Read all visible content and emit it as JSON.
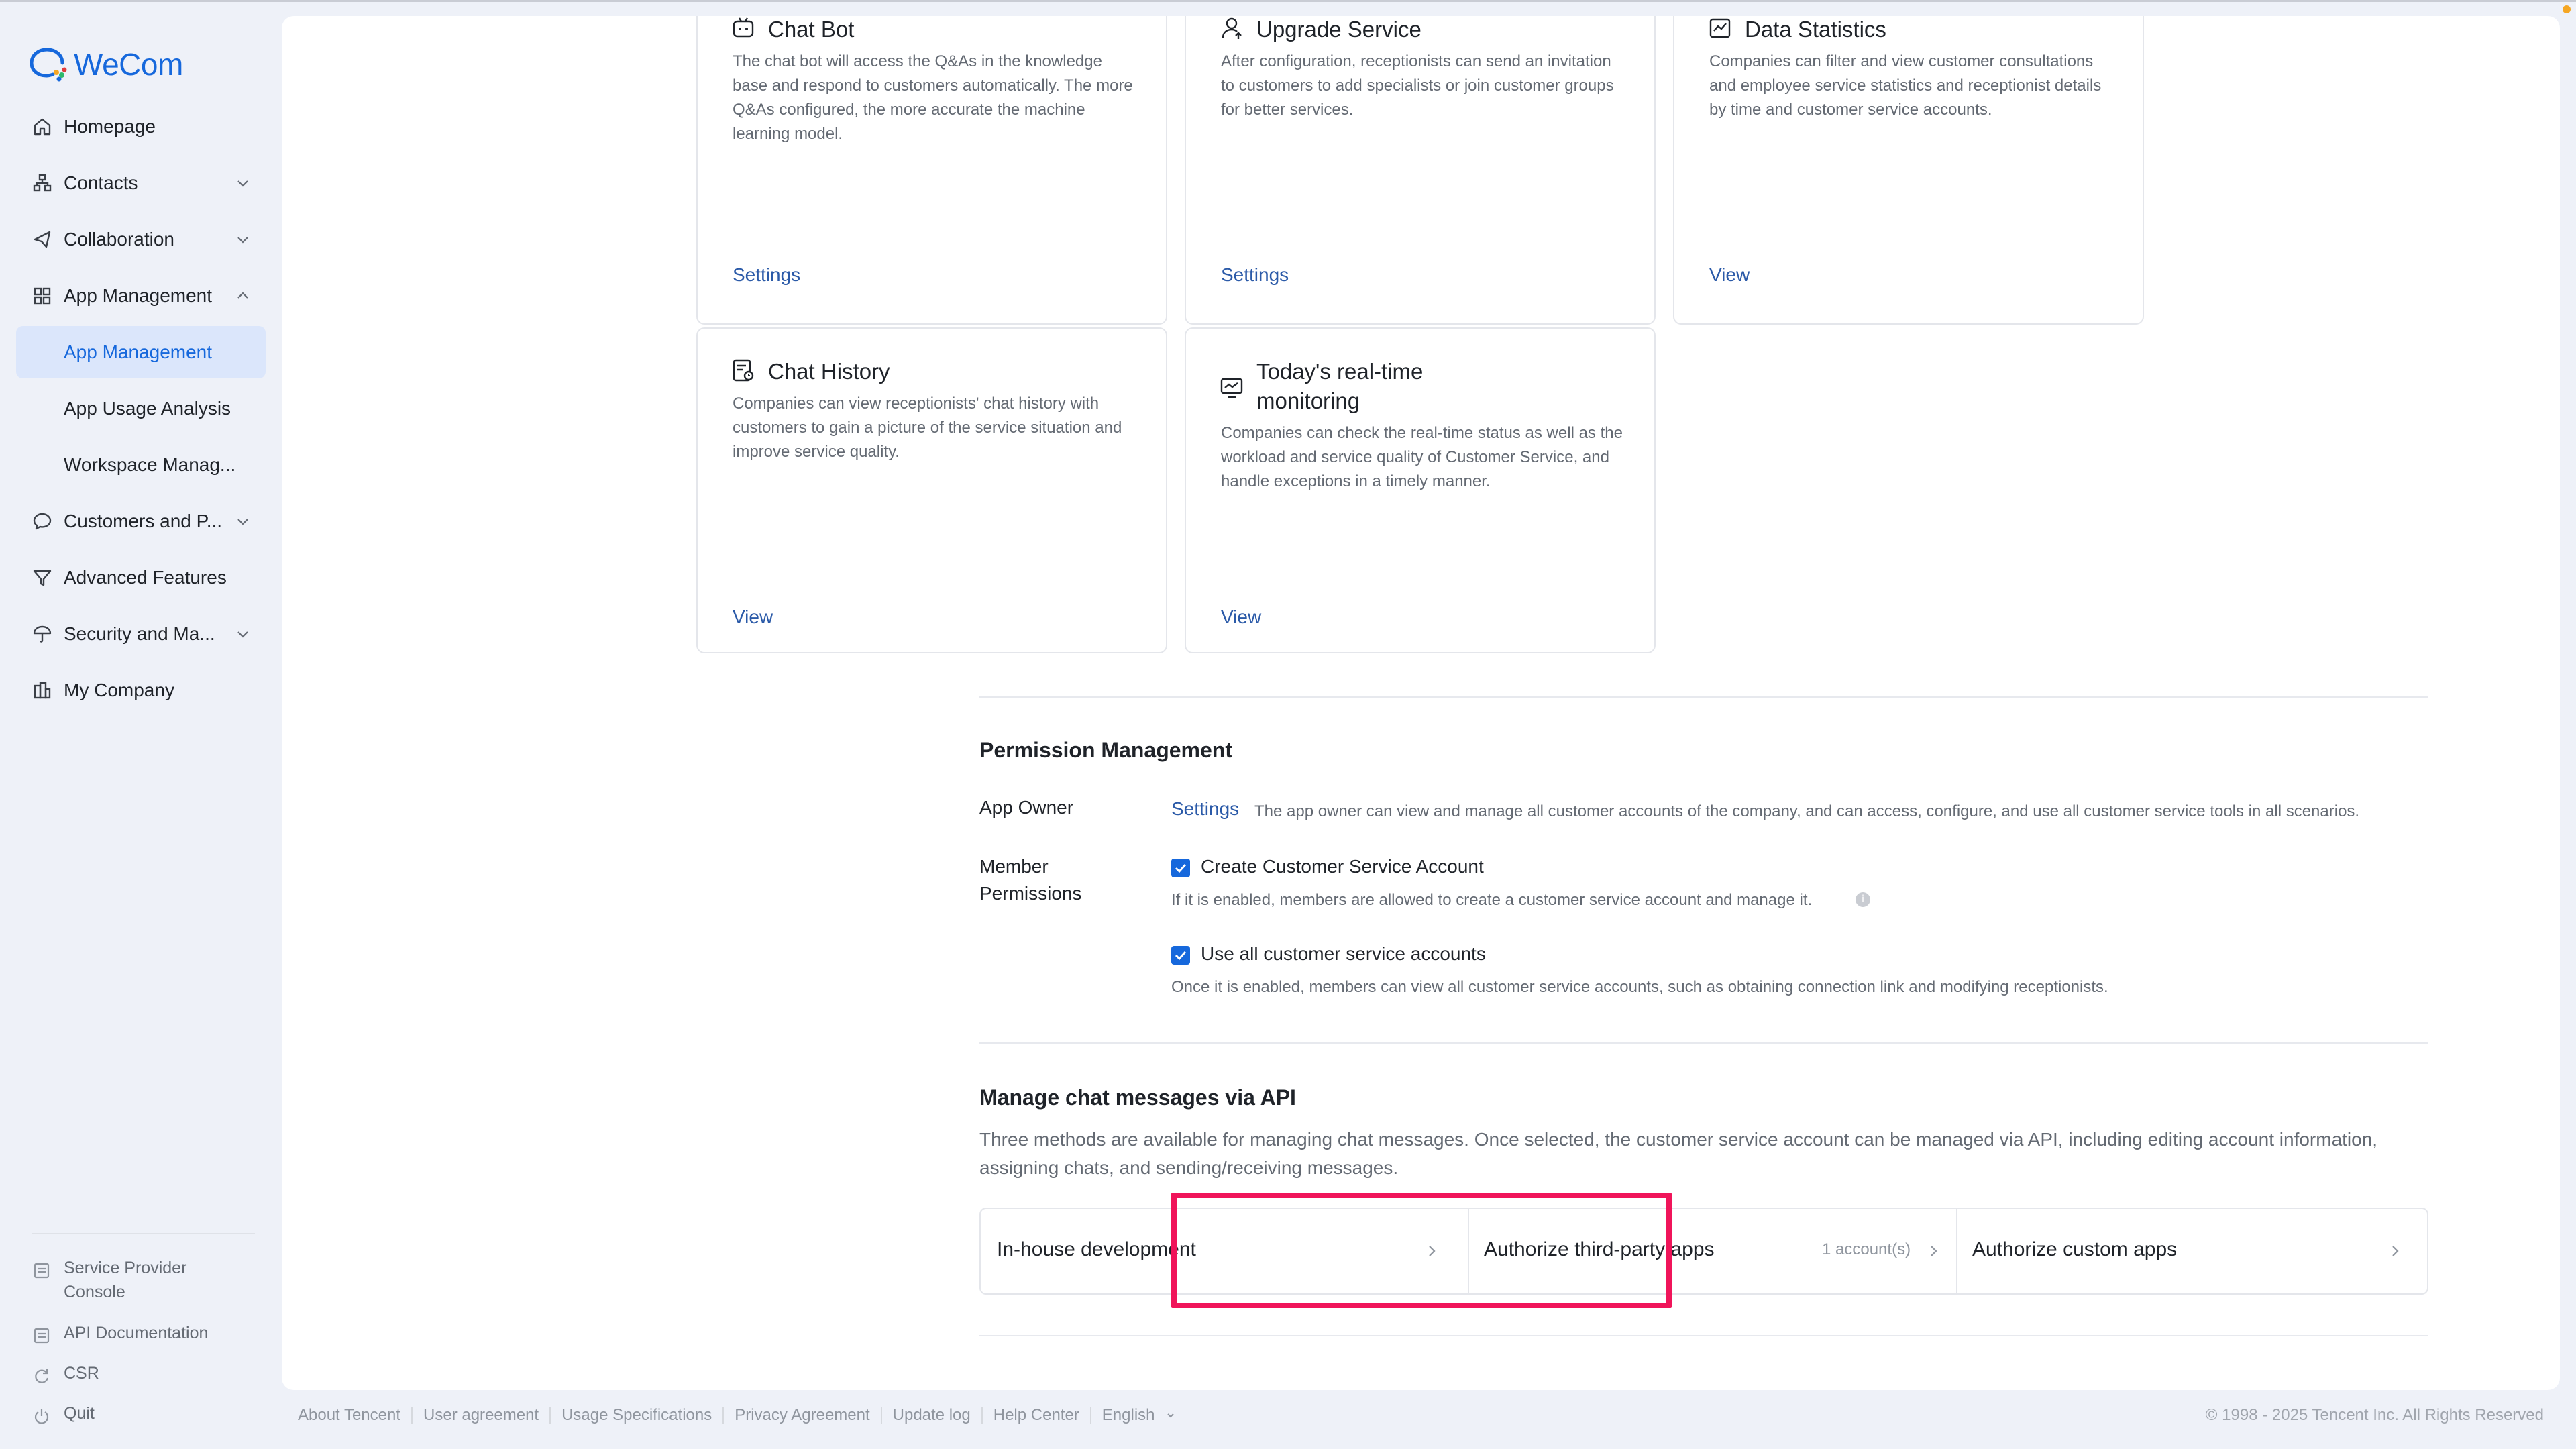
{
  "app": {
    "name": "WeCom",
    "brand_color": "#1668dc",
    "highlight_color": "#f0145a"
  },
  "sidebar": {
    "items": [
      {
        "label": "Homepage",
        "icon": "home-icon"
      },
      {
        "label": "Contacts",
        "icon": "contacts-icon",
        "expandable": true
      },
      {
        "label": "Collaboration",
        "icon": "collaboration-icon",
        "expandable": true
      },
      {
        "label": "App Management",
        "icon": "apps-icon",
        "expandable": true,
        "expanded": true
      },
      {
        "label": "App Management",
        "sub": true,
        "active": true
      },
      {
        "label": "App Usage Analysis",
        "sub": true
      },
      {
        "label": "Workspace Manag...",
        "sub": true
      },
      {
        "label": "Customers and P...",
        "icon": "chat-bubble-icon",
        "expandable": true
      },
      {
        "label": "Advanced Features",
        "icon": "filter-icon"
      },
      {
        "label": "Security and Ma...",
        "icon": "umbrella-icon",
        "expandable": true
      },
      {
        "label": "My Company",
        "icon": "company-icon"
      }
    ],
    "footer_items": [
      {
        "label": "Service Provider Console",
        "icon": "console-icon"
      },
      {
        "label": "API Documentation",
        "icon": "document-icon"
      },
      {
        "label": "CSR",
        "icon": "refresh-icon"
      },
      {
        "label": "Quit",
        "icon": "power-icon"
      }
    ]
  },
  "tools": [
    {
      "title": "Chat Bot",
      "icon": "robot-icon",
      "description": "The chat bot will access the Q&As in the knowledge base and respond to customers automatically. The more Q&As configured, the more accurate the machine learning model.",
      "link": "Settings"
    },
    {
      "title": "Upgrade Service",
      "icon": "person-upgrade-icon",
      "description": "After configuration, receptionists can send an invitation to customers to add specialists or join customer groups for better services.",
      "link": "Settings"
    },
    {
      "title": "Data Statistics",
      "icon": "chart-icon",
      "description": "Companies can filter and view customer consultations and employee service statistics and receptionist details by time and customer service accounts.",
      "link": "View"
    },
    {
      "title": "Chat History",
      "icon": "chat-history-icon",
      "description": "Companies can view receptionists' chat history with customers to gain a picture of the service situation and improve service quality.",
      "link": "View"
    },
    {
      "title": "Today's real-time monitoring",
      "icon": "monitor-icon",
      "description": "Companies can check the real-time status as well as the workload and service quality of Customer Service, and handle exceptions in a timely manner.",
      "link": "View"
    }
  ],
  "permission": {
    "title": "Permission Management",
    "app_owner_label": "App Owner",
    "app_owner_link": "Settings",
    "app_owner_text": "The app owner can view and manage all customer accounts of the company, and can access, configure, and use all customer service tools in all scenarios.",
    "member_label": "Member Permissions",
    "options": [
      {
        "label": "Create Customer Service Account",
        "checked": true,
        "hint": "If it is enabled, members are allowed to create a customer service account and manage it."
      },
      {
        "label": "Use all customer service accounts",
        "checked": true,
        "hint": "Once it is enabled, members can view all customer service accounts, such as obtaining connection link and modifying receptionists."
      }
    ]
  },
  "api": {
    "title": "Manage chat messages via API",
    "description": "Three methods are available for managing chat messages. Once selected, the customer service account can be managed via API, including editing account information, assigning chats, and sending/receiving messages.",
    "options": [
      {
        "label": "In-house development",
        "count": ""
      },
      {
        "label": "Authorize third-party apps",
        "count": "1 account(s)",
        "highlighted": true
      },
      {
        "label": "Authorize custom apps",
        "count": ""
      }
    ]
  },
  "footer": {
    "links": [
      "About Tencent",
      "User agreement",
      "Usage Specifications",
      "Privacy Agreement",
      "Update log",
      "Help Center",
      "English"
    ],
    "copyright": "© 1998 - 2025 Tencent Inc. All Rights Reserved"
  }
}
